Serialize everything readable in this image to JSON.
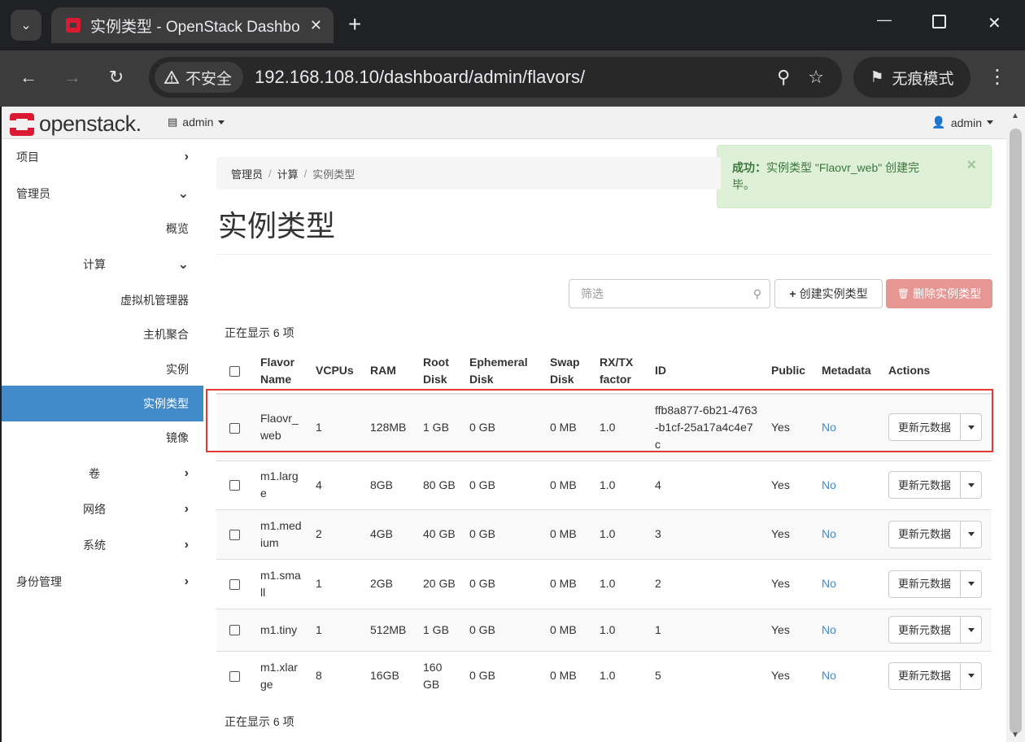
{
  "browser": {
    "tab_title": "实例类型 - OpenStack Dashboard",
    "new_tab": "+",
    "security_label": "不安全",
    "url": "192.168.108.10/dashboard/admin/flavors/",
    "incognito_label": "无痕模式"
  },
  "topnav": {
    "logo_text": "openstack.",
    "project": "admin",
    "user": "admin"
  },
  "sidebar": {
    "project": "项目",
    "admin": "管理员",
    "overview": "概览",
    "compute": "计算",
    "hypervisors": "虚拟机管理器",
    "aggregates": "主机聚合",
    "instances": "实例",
    "flavors": "实例类型",
    "images": "镜像",
    "volumes": "卷",
    "network": "网络",
    "system": "系统",
    "identity": "身份管理"
  },
  "alert": {
    "strong": "成功：",
    "message": "实例类型 \"Flaovr_web\" 创建完毕。",
    "close": "×"
  },
  "breadcrumb": {
    "level1": "管理员",
    "level2": "计算",
    "level3": "实例类型"
  },
  "page_title": "实例类型",
  "toolbar": {
    "filter_placeholder": "筛选",
    "create_label": "创建实例类型",
    "delete_label": "删除实例类型"
  },
  "count_text": "正在显示 6 项",
  "table": {
    "headers": {
      "name": "Flavor Name",
      "vcpus": "VCPUs",
      "ram": "RAM",
      "root": "Root Disk",
      "ephemeral": "Ephemeral Disk",
      "swap": "Swap Disk",
      "rxtx": "RX/TX factor",
      "id": "ID",
      "public": "Public",
      "metadata": "Metadata",
      "actions": "Actions"
    },
    "action_label": "更新元数据",
    "rows": [
      {
        "name": "Flaovr_web",
        "vcpus": "1",
        "ram": "128MB",
        "root": "1 GB",
        "ephemeral": "0 GB",
        "swap": "0 MB",
        "rxtx": "1.0",
        "id": "ffb8a877-6b21-4763-b1cf-25a17a4c4e7c",
        "public": "Yes",
        "metadata": "No"
      },
      {
        "name": "m1.large",
        "vcpus": "4",
        "ram": "8GB",
        "root": "80 GB",
        "ephemeral": "0 GB",
        "swap": "0 MB",
        "rxtx": "1.0",
        "id": "4",
        "public": "Yes",
        "metadata": "No"
      },
      {
        "name": "m1.medium",
        "vcpus": "2",
        "ram": "4GB",
        "root": "40 GB",
        "ephemeral": "0 GB",
        "swap": "0 MB",
        "rxtx": "1.0",
        "id": "3",
        "public": "Yes",
        "metadata": "No"
      },
      {
        "name": "m1.small",
        "vcpus": "1",
        "ram": "2GB",
        "root": "20 GB",
        "ephemeral": "0 GB",
        "swap": "0 MB",
        "rxtx": "1.0",
        "id": "2",
        "public": "Yes",
        "metadata": "No"
      },
      {
        "name": "m1.tiny",
        "vcpus": "1",
        "ram": "512MB",
        "root": "1 GB",
        "ephemeral": "0 GB",
        "swap": "0 MB",
        "rxtx": "1.0",
        "id": "1",
        "public": "Yes",
        "metadata": "No"
      },
      {
        "name": "m1.xlarge",
        "vcpus": "8",
        "ram": "16GB",
        "root": "160 GB",
        "ephemeral": "0 GB",
        "swap": "0 MB",
        "rxtx": "1.0",
        "id": "5",
        "public": "Yes",
        "metadata": "No"
      }
    ]
  },
  "colors": {
    "accent": "#428bca",
    "danger": "#e79793",
    "success_bg": "#dff0d8",
    "brand": "#da1a32",
    "highlight": "#e53935"
  }
}
